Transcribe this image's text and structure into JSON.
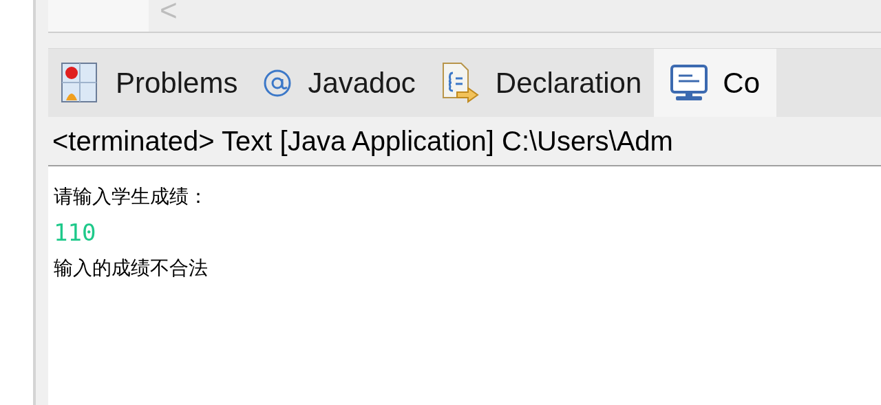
{
  "editor": {
    "scroll_arrow": "<"
  },
  "tabs": [
    {
      "label": "Problems",
      "kind": "problems",
      "selected": false
    },
    {
      "label": "Javadoc",
      "kind": "javadoc",
      "selected": false
    },
    {
      "label": "Declaration",
      "kind": "declaration",
      "selected": false
    },
    {
      "label": "Co",
      "kind": "console",
      "selected": true
    }
  ],
  "console": {
    "description": "<terminated> Text [Java Application] C:\\Users\\Adm",
    "lines": [
      {
        "text": "请输入学生成绩：",
        "kind": "output"
      },
      {
        "text": "110",
        "kind": "input"
      },
      {
        "text": "输入的成绩不合法",
        "kind": "output"
      }
    ]
  }
}
